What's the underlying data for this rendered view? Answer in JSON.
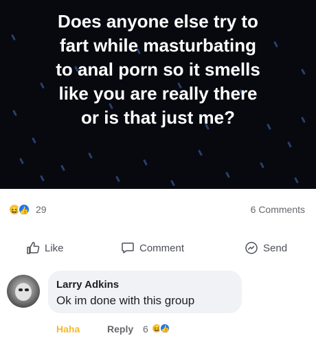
{
  "post": {
    "text": "Does anyone else try to\nfart while masturbating\nto anal porn so it smells\nlike you are really there\nor is that just me?",
    "background_color": "#07090f",
    "text_color": "#ffffff"
  },
  "reactions": {
    "icons": [
      "haha-emoji-icon",
      "like-thumb-icon"
    ],
    "count": "29",
    "comments_label": "6 Comments"
  },
  "actions": {
    "like": "Like",
    "comment": "Comment",
    "send": "Send"
  },
  "comment": {
    "author": "Larry Adkins",
    "text": "Ok im done with this group",
    "reaction_label": "Haha",
    "reply_label": "Reply",
    "reaction_count": "6",
    "reaction_color": "#f7b928"
  },
  "colors": {
    "accent_blue": "#1877f2",
    "muted_text": "#65676b",
    "bubble_bg": "#f0f2f5"
  }
}
